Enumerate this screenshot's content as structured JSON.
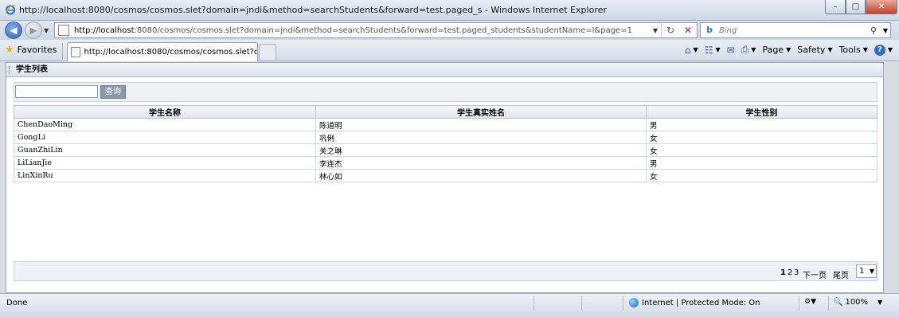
{
  "window": {
    "title": "http://localhost:8080/cosmos/cosmos.slet?domain=jndi&method=searchStudents&forward=test.paged_s - Windows Internet Explorer"
  },
  "address_bar": {
    "url_host": "http://localhost",
    "url_rest": ":8080/cosmos/cosmos.slet?domain=jndi&method=searchStudents&forward=test.paged_students&studentName=l&page=1"
  },
  "search": {
    "placeholder": "Bing"
  },
  "favorites": {
    "label": "Favorites"
  },
  "tab": {
    "label": "http://localhost:8080/cosmos/cosmos.slet?doma..."
  },
  "command_bar": {
    "page_label": "Page",
    "safety_label": "Safety",
    "tools_label": "Tools",
    "help_label": "?"
  },
  "panel": {
    "title": "学生列表"
  },
  "toolbar": {
    "search_value": "",
    "query_button": "查询"
  },
  "table": {
    "headers": [
      "学生名称",
      "学生真实姓名",
      "学生性别"
    ],
    "rows": [
      [
        "ChenDaoMing",
        "陈道明",
        "男"
      ],
      [
        "GongLi",
        "巩俐",
        "女"
      ],
      [
        "GuanZhiLin",
        "关之琳",
        "女"
      ],
      [
        "LiLianJie",
        "李连杰",
        "男"
      ],
      [
        "LinXinRu",
        "林心如",
        "女"
      ]
    ]
  },
  "pager": {
    "page1": "1",
    "page2": "2",
    "page3": "3",
    "next": "下一页",
    "last": "尾页",
    "selected_page": "1"
  },
  "status_bar": {
    "status": "Done",
    "zone": "Internet | Protected Mode: On",
    "zoom": "100%"
  }
}
